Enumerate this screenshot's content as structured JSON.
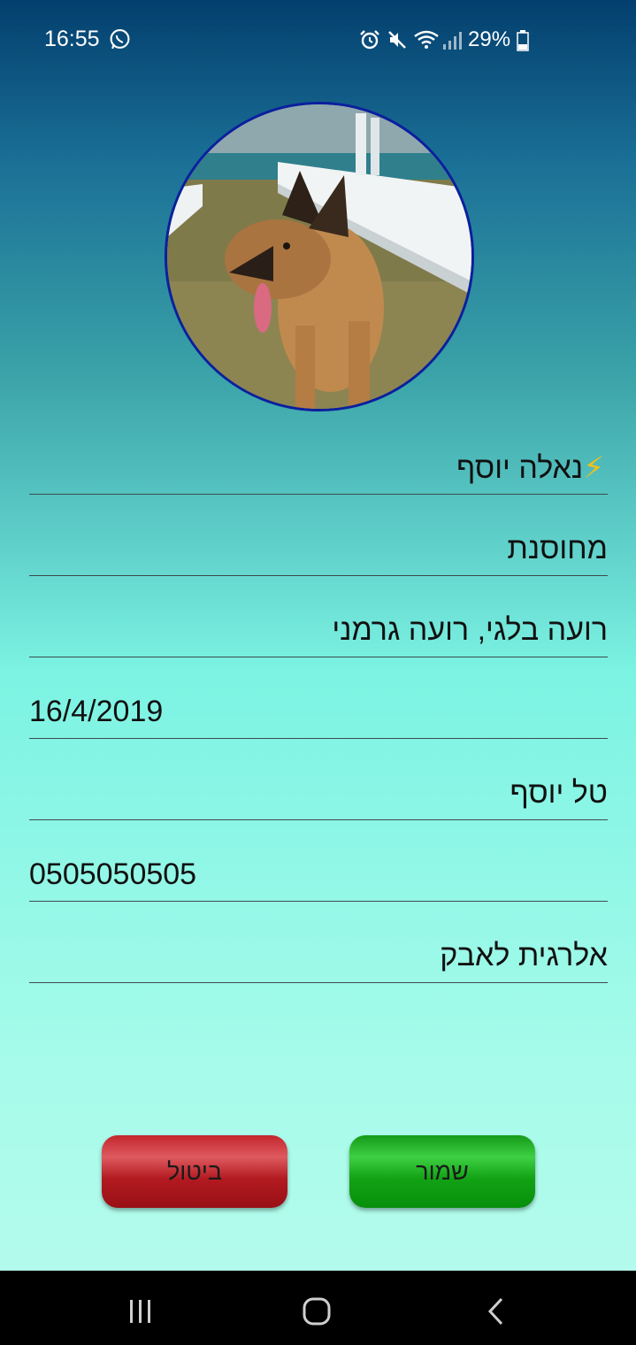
{
  "status_bar": {
    "time": "16:55",
    "battery": "29%",
    "icons": [
      "whatsapp-icon",
      "alarm-icon",
      "mute-icon",
      "wifi-icon",
      "signal-icon",
      "battery-icon"
    ]
  },
  "profile": {
    "photo": "dog-photo"
  },
  "form": {
    "name": "נאלה יוסף",
    "vaccinated": "מחוסנת",
    "breed": "רועה בלגי, רועה גרמני",
    "birth_date": "16/4/2019",
    "owner_name": "טל יוסף",
    "phone": "0505050505",
    "notes": "אלרגית לאבק"
  },
  "buttons": {
    "cancel_label": "ביטול",
    "save_label": "שמור"
  },
  "colors": {
    "cancel": "#c2262c",
    "save": "#149a18",
    "avatar_border": "#0b1f9e"
  }
}
